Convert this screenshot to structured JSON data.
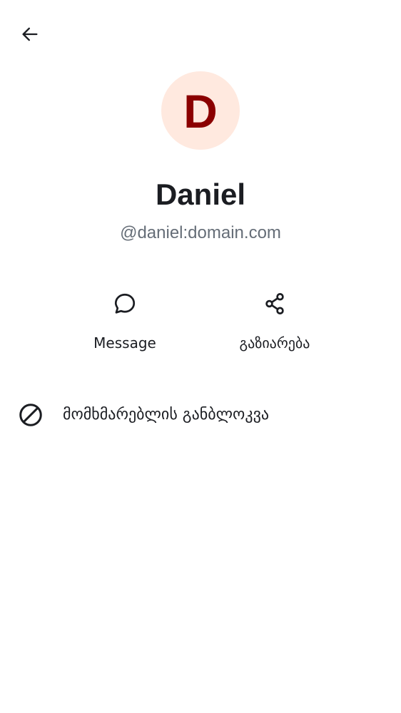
{
  "nav": {
    "back_icon": "arrow-left-icon"
  },
  "profile": {
    "avatar_letter": "D",
    "avatar_bg_color": "#ffe9df",
    "avatar_letter_color": "#8b0000",
    "display_name": "Daniel",
    "user_id": "@daniel:domain.com"
  },
  "actions": [
    {
      "icon": "chat-bubble-icon",
      "label": "Message"
    },
    {
      "icon": "share-icon",
      "label": "გაზიარება"
    }
  ],
  "menu": {
    "block_user": {
      "icon": "block-icon",
      "label": "მომხმარებლის განბლოკვა"
    }
  }
}
